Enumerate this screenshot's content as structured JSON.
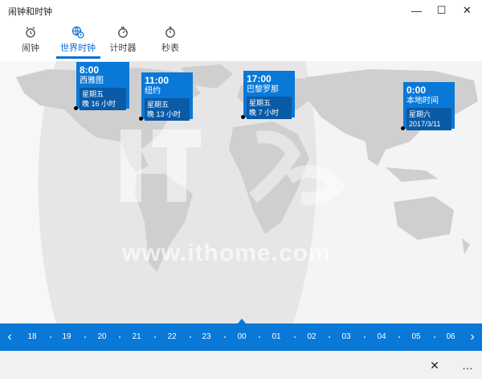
{
  "app": {
    "title": "闹钟和时钟"
  },
  "window": {
    "minimize": "—",
    "maximize": "☐",
    "close": "✕"
  },
  "tabs": [
    {
      "label": "闹钟",
      "icon": "alarm-clock-icon"
    },
    {
      "label": "世界时钟",
      "icon": "world-clock-icon"
    },
    {
      "label": "计时器",
      "icon": "timer-icon"
    },
    {
      "label": "秒表",
      "icon": "stopwatch-icon"
    }
  ],
  "active_tab": "世界时钟",
  "accent_color": "#0a78d7",
  "watermark": {
    "logo_text": "IT之家",
    "url": "www.ithome.com"
  },
  "cards": {
    "seattle": {
      "time": "8:00",
      "city": "西雅图",
      "day": "星期五",
      "diff": "晚 16 小时"
    },
    "newyork": {
      "time": "11:00",
      "city": "纽约",
      "day": "星期五",
      "diff": "晚 13 小时"
    },
    "paris": {
      "time": "17:00",
      "city": "巴黎罗那",
      "day": "星期五",
      "diff": "晚 7 小时"
    },
    "local": {
      "time": "0:00",
      "city": "本地时间",
      "day": "星期六",
      "diff": "2017/3/11"
    }
  },
  "timeline": {
    "hours": [
      "18",
      "19",
      "20",
      "21",
      "22",
      "23",
      "00",
      "01",
      "02",
      "03",
      "04",
      "05",
      "06"
    ],
    "prev": "‹",
    "next": "›"
  },
  "bottom": {
    "close_label": "✕",
    "more_label": "…"
  }
}
